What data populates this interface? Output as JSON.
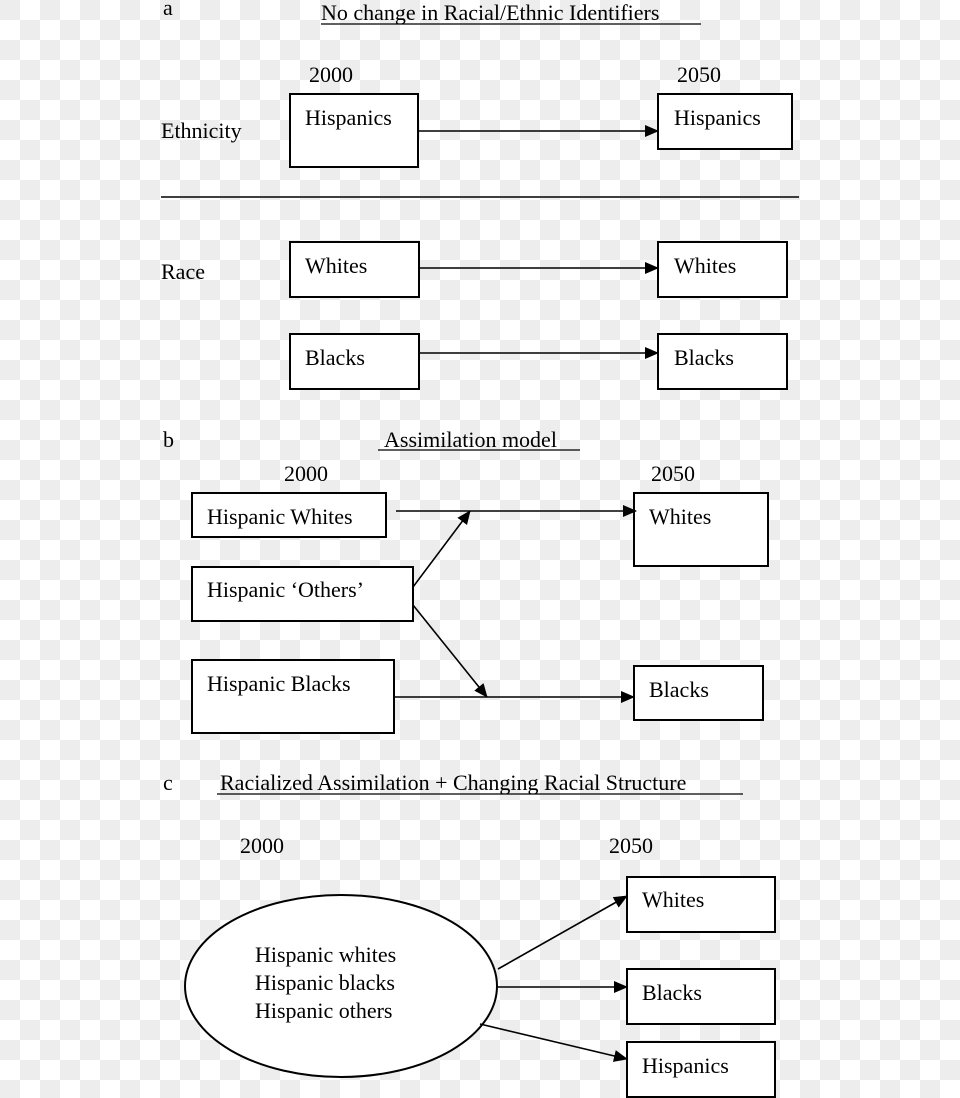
{
  "panel_a": {
    "letter": "a",
    "title": "No change in Racial/Ethnic Identifiers",
    "year_start": "2000",
    "year_end": "2050",
    "row_labels": {
      "ethnicity": "Ethnicity",
      "race": "Race"
    },
    "ethnicity": {
      "from": "Hispanics",
      "to": "Hispanics"
    },
    "race": [
      {
        "from": "Whites",
        "to": "Whites"
      },
      {
        "from": "Blacks",
        "to": "Blacks"
      }
    ]
  },
  "panel_b": {
    "letter": "b",
    "title": "Assimilation model",
    "year_start": "2000",
    "year_end": "2050",
    "sources": [
      "Hispanic Whites",
      "Hispanic ‘Others’",
      "Hispanic Blacks"
    ],
    "targets": [
      "Whites",
      "Blacks"
    ],
    "flows": [
      {
        "from": "Hispanic Whites",
        "to": "Whites"
      },
      {
        "from": "Hispanic ‘Others’",
        "to": "Whites"
      },
      {
        "from": "Hispanic ‘Others’",
        "to": "Blacks"
      },
      {
        "from": "Hispanic Blacks",
        "to": "Blacks"
      }
    ]
  },
  "panel_c": {
    "letter": "c",
    "title": "Racialized Assimilation + Changing Racial Structure",
    "year_start": "2000",
    "year_end": "2050",
    "source_group": [
      "Hispanic whites",
      "Hispanic blacks",
      "Hispanic others"
    ],
    "targets": [
      "Whites",
      "Blacks",
      "Hispanics"
    ]
  }
}
